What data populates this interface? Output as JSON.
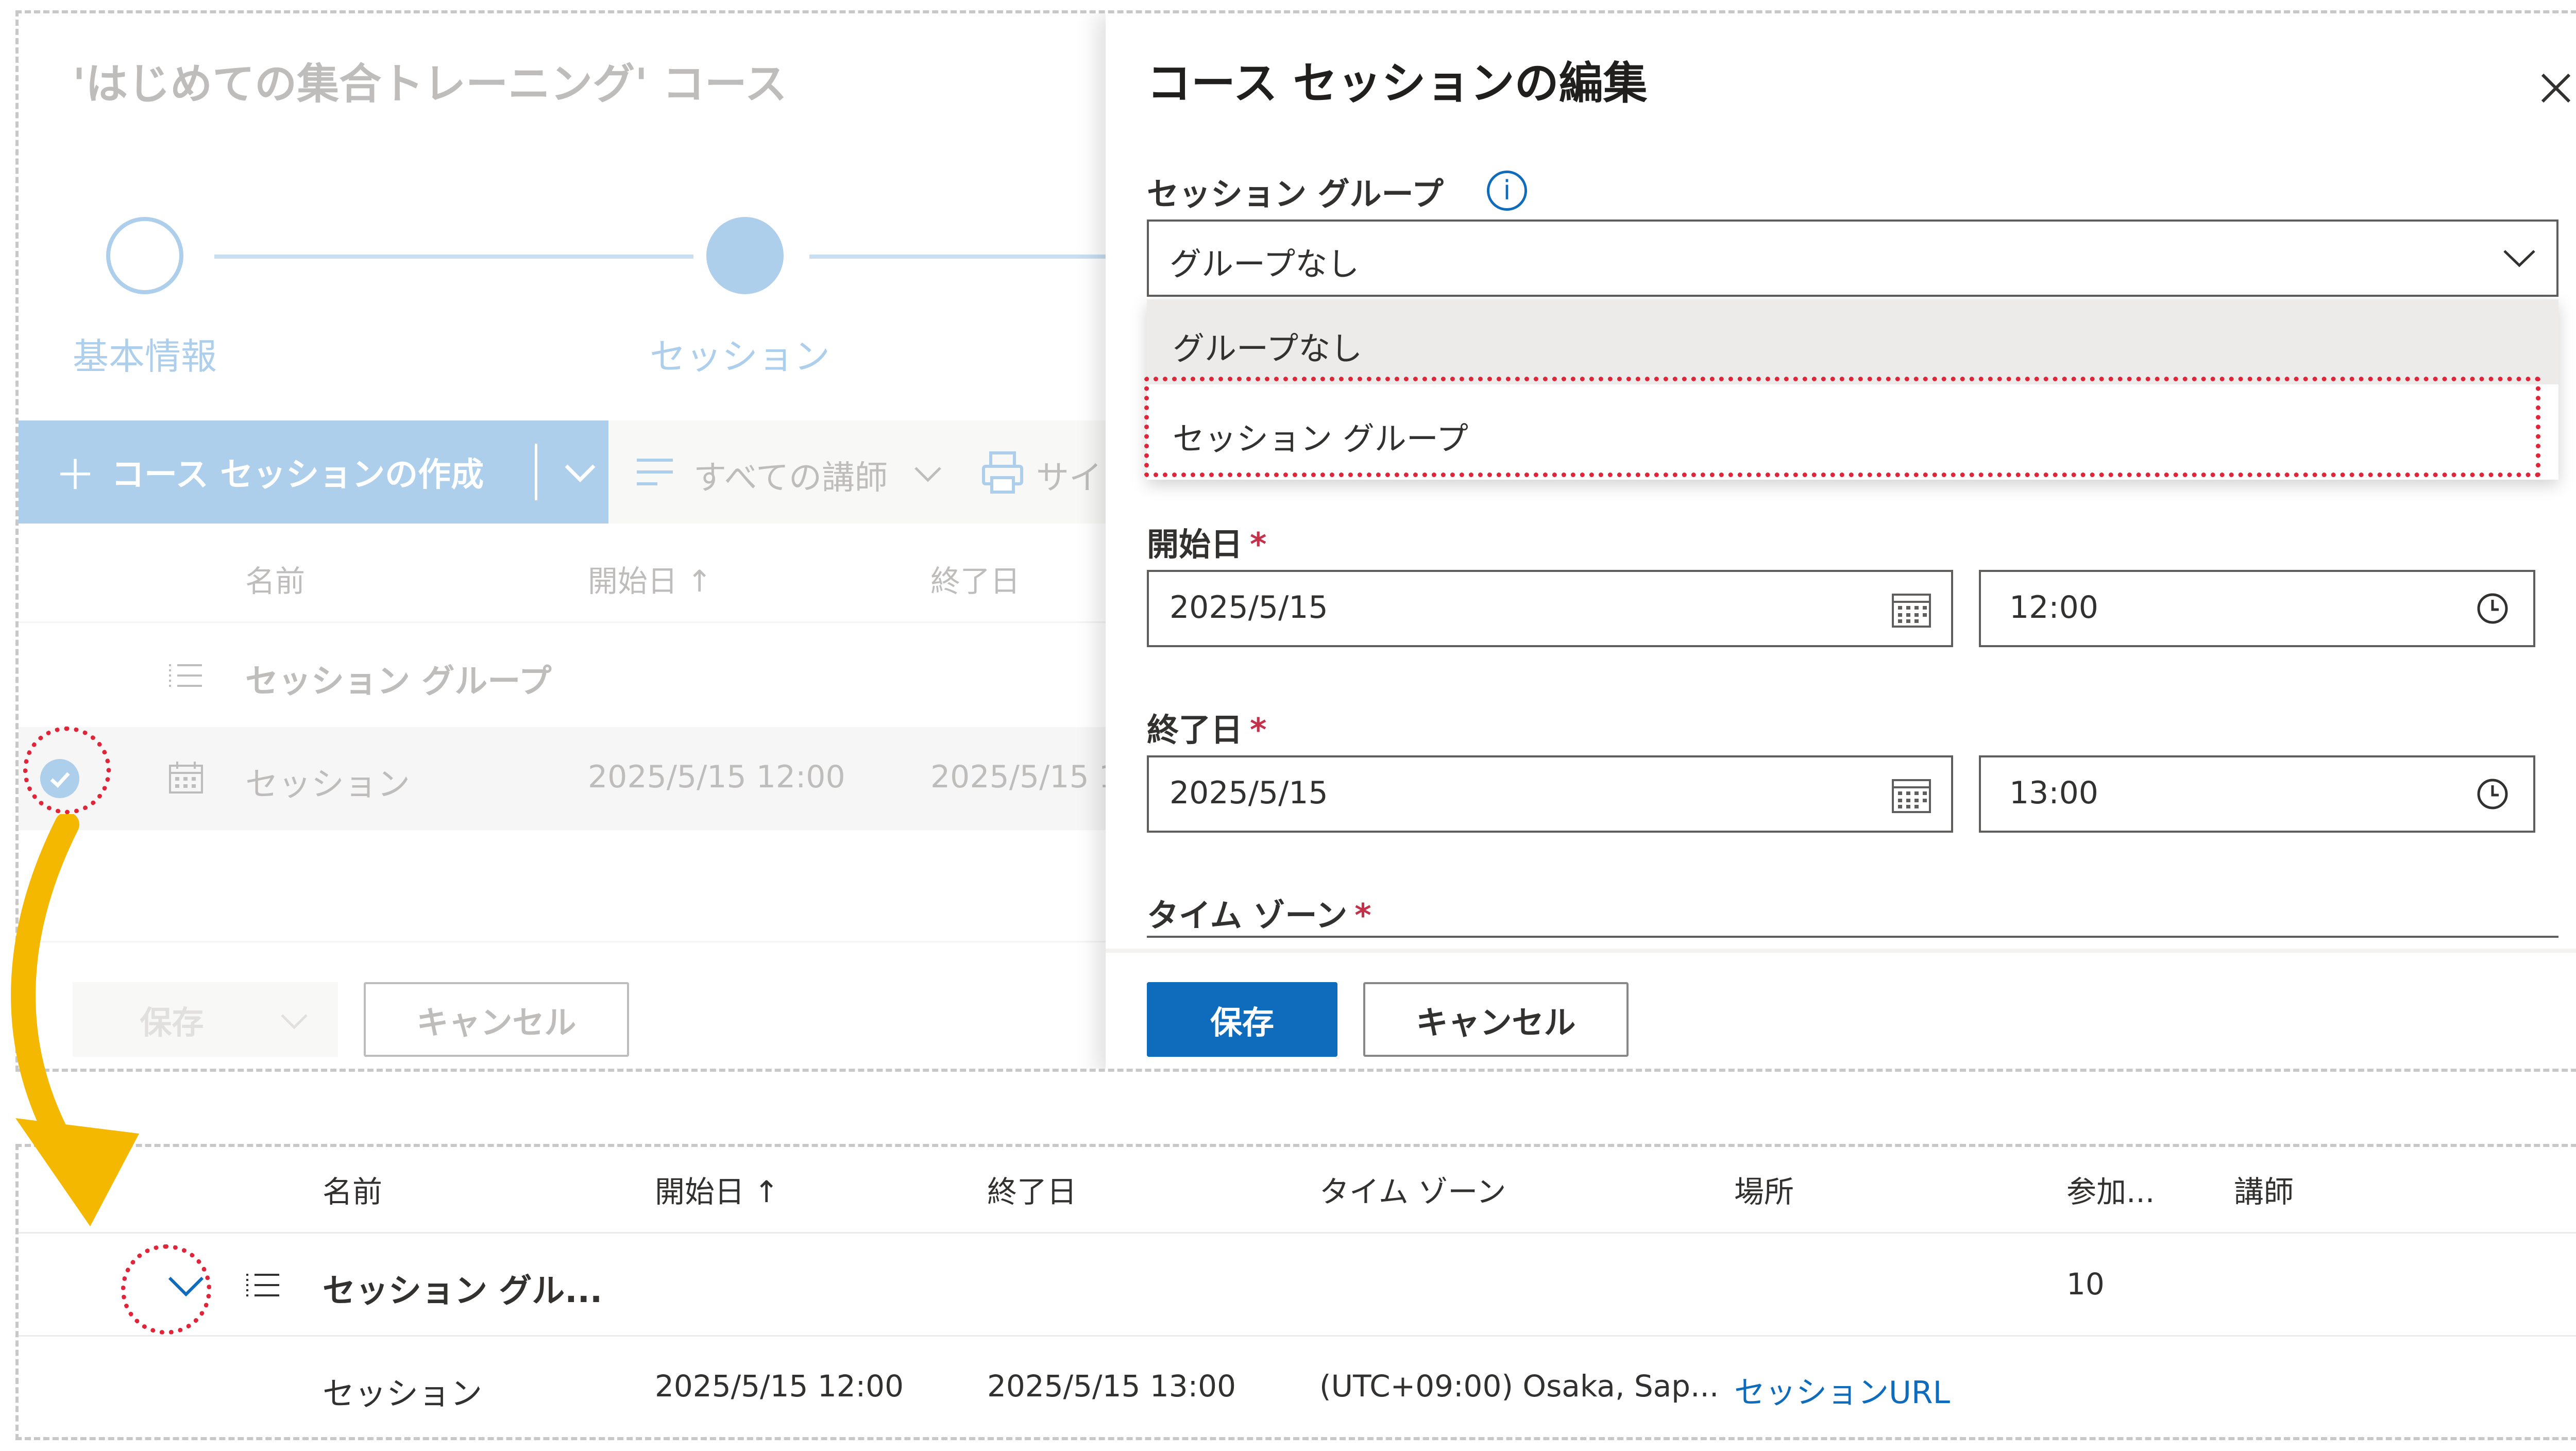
{
  "background_page": {
    "title": "'はじめての集合トレーニング' コース",
    "steps": [
      {
        "label": "基本情報",
        "state": "incomplete"
      },
      {
        "label": "セッション",
        "state": "current"
      }
    ],
    "toolbar": {
      "create_label": "コース セッションの作成",
      "instructors_label": "すべての講師",
      "sign_label": "サイ"
    },
    "columns": {
      "name": "名前",
      "start": "開始日 ↑",
      "end": "終了日"
    },
    "rows": [
      {
        "type": "group",
        "name": "セッション グループ"
      },
      {
        "type": "session",
        "name": "セッション",
        "start": "2025/5/15 12:00",
        "end": "2025/5/15 1"
      }
    ],
    "save_label": "保存",
    "cancel_label": "キャンセル"
  },
  "panel": {
    "title": "コース セッションの編集",
    "group_label": "セッション グループ",
    "group_value": "グループなし",
    "dropdown_options": [
      "グループなし",
      "セッション グループ"
    ],
    "start_label": "開始日",
    "start_date": "2025/5/15",
    "start_time": "12:00",
    "end_label": "終了日",
    "end_date": "2025/5/15",
    "end_time": "13:00",
    "timezone_label": "タイム ゾーン",
    "required_mark": "*",
    "save_label": "保存",
    "cancel_label": "キャンセル"
  },
  "result_table": {
    "columns": {
      "name": "名前",
      "start": "開始日 ↑",
      "end": "終了日",
      "timezone": "タイム ゾーン",
      "location": "場所",
      "participants": "参加...",
      "instructor": "講師"
    },
    "group_row": {
      "name": "セッション グル...",
      "participants": "10"
    },
    "session_row": {
      "name": "セッション",
      "start": "2025/5/15 12:00",
      "end": "2025/5/15 13:00",
      "timezone": "(UTC+09:00) Osaka, Sap...",
      "location_link": "セッションURL"
    }
  },
  "colors": {
    "accent_blue": "#0f6cbd",
    "step_blue": "#6aa8dc",
    "annotation_red": "#e0253b",
    "arrow_yellow": "#f5b800"
  }
}
